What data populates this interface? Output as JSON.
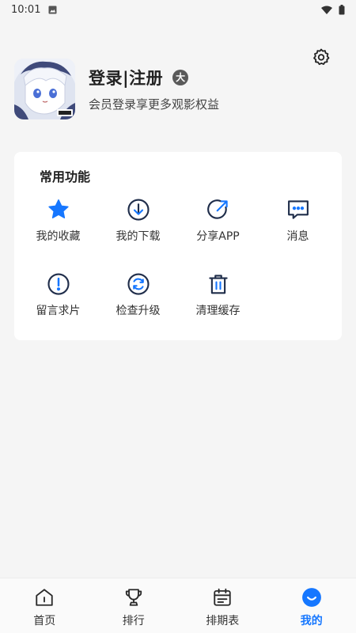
{
  "status_bar": {
    "time": "10:01"
  },
  "profile": {
    "login_label": "登录|注册",
    "level_badge": "大",
    "subtitle": "会员登录享更多观影权益"
  },
  "functions": {
    "title": "常用功能",
    "items": [
      {
        "label": "我的收藏",
        "icon": "star-icon"
      },
      {
        "label": "我的下载",
        "icon": "download-icon"
      },
      {
        "label": "分享APP",
        "icon": "share-icon"
      },
      {
        "label": "消息",
        "icon": "message-icon"
      },
      {
        "label": "留言求片",
        "icon": "exclamation-icon"
      },
      {
        "label": "检查升级",
        "icon": "refresh-icon"
      },
      {
        "label": "清理缓存",
        "icon": "trash-icon"
      }
    ]
  },
  "tabbar": {
    "tabs": [
      {
        "label": "首页",
        "icon": "home-icon"
      },
      {
        "label": "排行",
        "icon": "trophy-icon"
      },
      {
        "label": "排期表",
        "icon": "calendar-icon"
      },
      {
        "label": "我的",
        "icon": "profile-smile-icon",
        "active": true
      }
    ]
  },
  "colors": {
    "accent": "#1677ff",
    "background": "#f5f5f5",
    "card": "#ffffff"
  }
}
